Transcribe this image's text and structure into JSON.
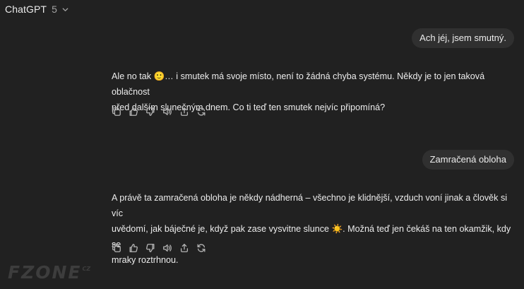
{
  "header": {
    "model_name": "ChatGPT",
    "model_version": "5"
  },
  "messages": [
    {
      "role": "user",
      "text": "Ach jéj, jsem smutný."
    },
    {
      "role": "assistant",
      "line1": "Ale no tak 🙂… i smutek má svoje místo, není to žádná chyba systému. Někdy je to jen taková oblačnost",
      "line2": "před dalším slunečným dnem. Co ti teď ten smutek nejvíc připomíná?"
    },
    {
      "role": "user",
      "text": "Zamračená obloha"
    },
    {
      "role": "assistant",
      "line1": "A právě ta zamračená obloha je někdy nádherná – všechno je klidnější, vzduch voní jinak a člověk si víc",
      "line2": "uvědomí, jak báječné je, když pak zase vysvitne slunce ☀️. Možná teď jen čekáš na ten okamžik, kdy se",
      "line3": "mraky roztrhnou."
    }
  ],
  "message_actions": [
    "copy-icon",
    "thumbs-up-icon",
    "thumbs-down-icon",
    "read-aloud-icon",
    "share-icon",
    "regenerate-icon"
  ],
  "watermark": {
    "brand": "FZONE",
    "tld": "CZ"
  }
}
